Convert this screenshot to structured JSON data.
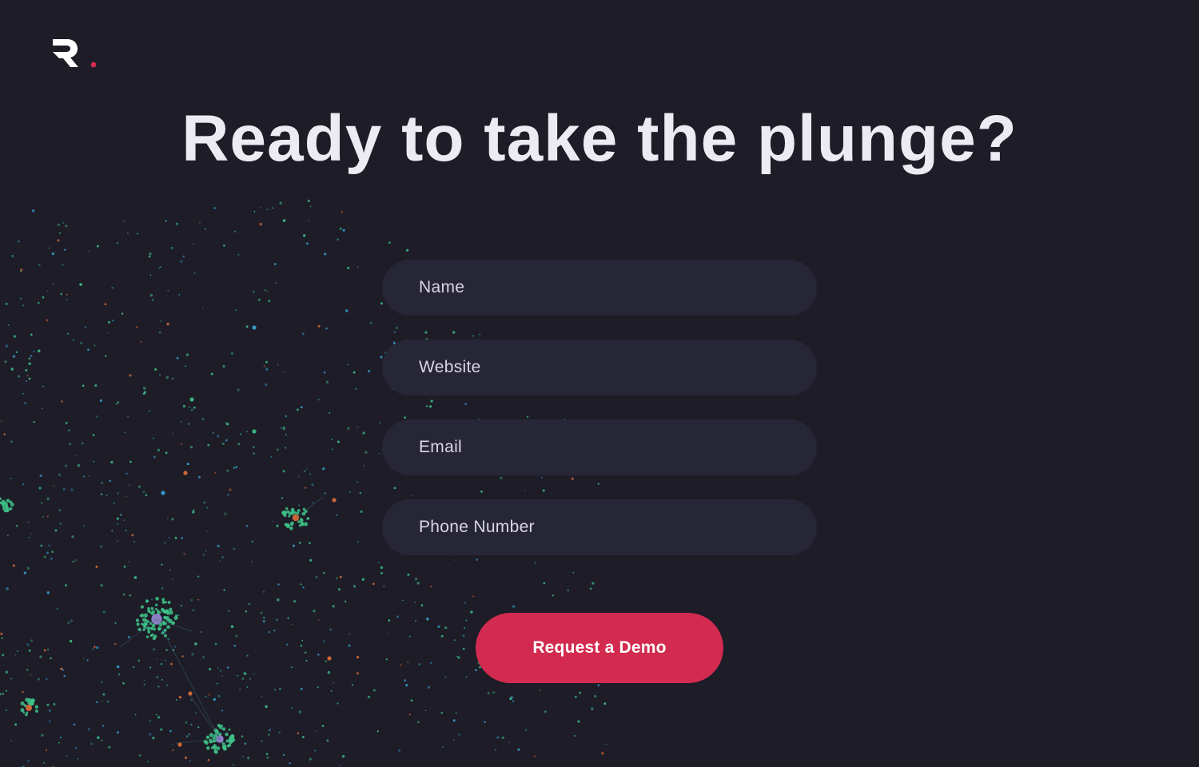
{
  "brand": {
    "logo_icon": "r-dot-logo",
    "accent_color": "#d22b4f"
  },
  "hero": {
    "headline": "Ready to take the plunge?"
  },
  "form": {
    "fields": [
      {
        "name": "name",
        "placeholder": "Name"
      },
      {
        "name": "website",
        "placeholder": "Website"
      },
      {
        "name": "email",
        "placeholder": "Email"
      },
      {
        "name": "phone",
        "placeholder": "Phone Number"
      }
    ],
    "submit_label": "Request a Demo"
  },
  "background": {
    "illustration": "network-graph",
    "node_colors": [
      "#3ec48a",
      "#3aa6d8",
      "#e0703a",
      "#9a8ad8"
    ]
  }
}
